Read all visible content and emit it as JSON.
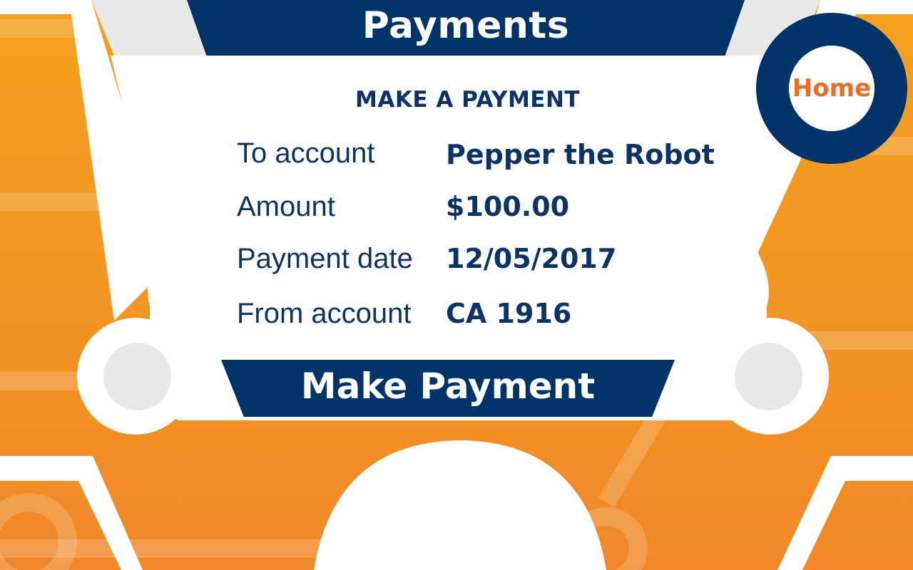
{
  "header": {
    "title": "Payments"
  },
  "nav": {
    "home_label": "Home"
  },
  "form": {
    "heading": "MAKE A PAYMENT",
    "rows": [
      {
        "label": "To account",
        "value": "Pepper the Robot"
      },
      {
        "label": "Amount",
        "value": "$100.00"
      },
      {
        "label": "Payment date",
        "value": "12/05/2017"
      },
      {
        "label": "From account",
        "value": "CA 1916"
      }
    ],
    "submit_label": "Make Payment"
  },
  "colors": {
    "accent_navy": "#003468",
    "background_orange": "#f39424",
    "home_text_orange": "#ef6b24",
    "panel_white": "#ffffff"
  }
}
